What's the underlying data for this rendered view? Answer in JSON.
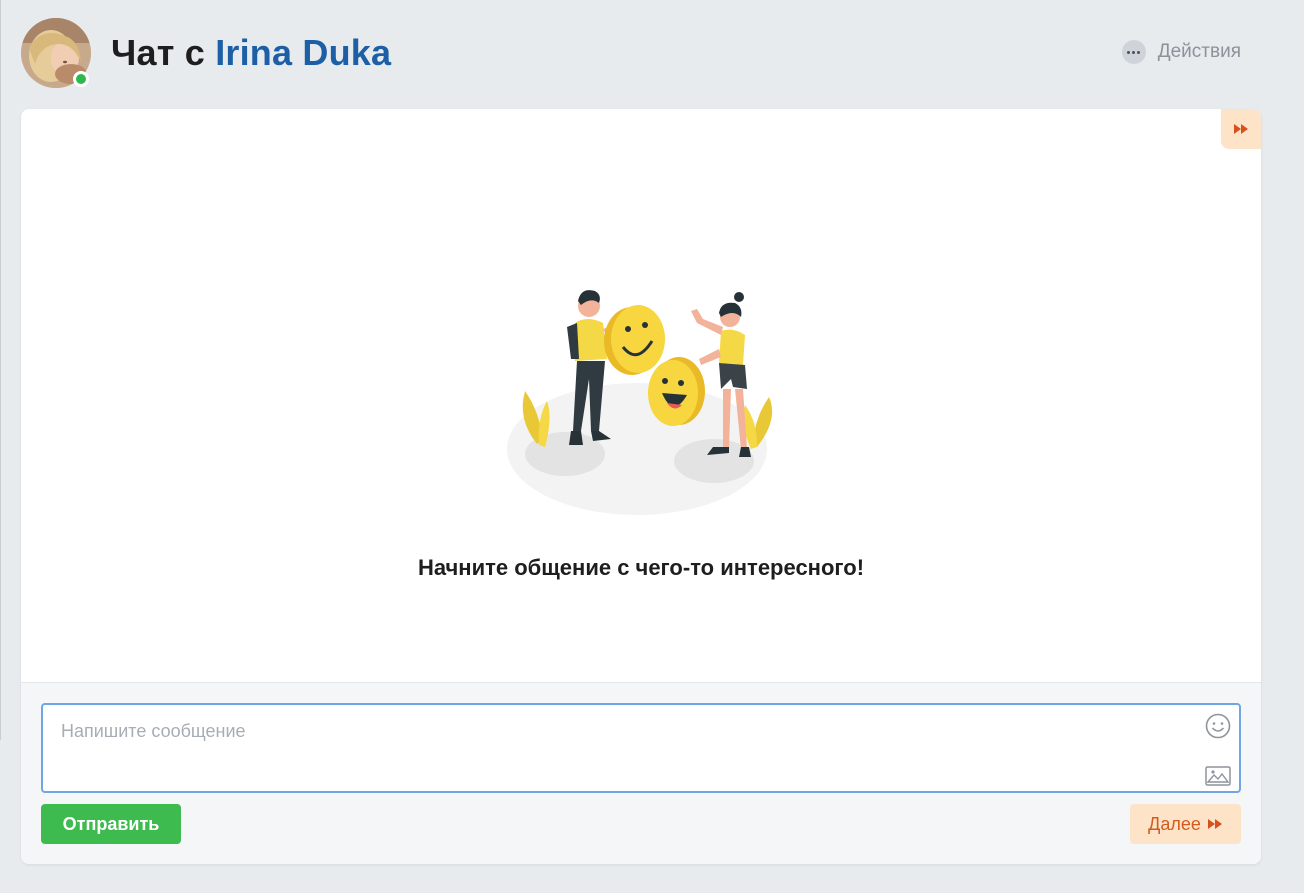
{
  "header": {
    "title_prefix": "Чат с",
    "contact_name": "Irina Duka",
    "online": true,
    "actions_label": "Действия"
  },
  "chat": {
    "empty_message": "Начните общение с чего-то интересного!",
    "illustration": "two-people-with-smiley-faces"
  },
  "composer": {
    "placeholder": "Напишите сообщение",
    "value": "",
    "send_label": "Отправить",
    "next_label": "Далее"
  },
  "colors": {
    "accent_blue": "#1d5fa6",
    "send_green": "#3dbb4f",
    "next_orange": "#d45a1d",
    "next_bg": "#fde4c8",
    "online_green": "#2db84d"
  },
  "icons": {
    "actions": "more-dots-icon",
    "skip": "fast-forward-icon",
    "emoji": "smiley-icon",
    "image": "image-icon"
  }
}
